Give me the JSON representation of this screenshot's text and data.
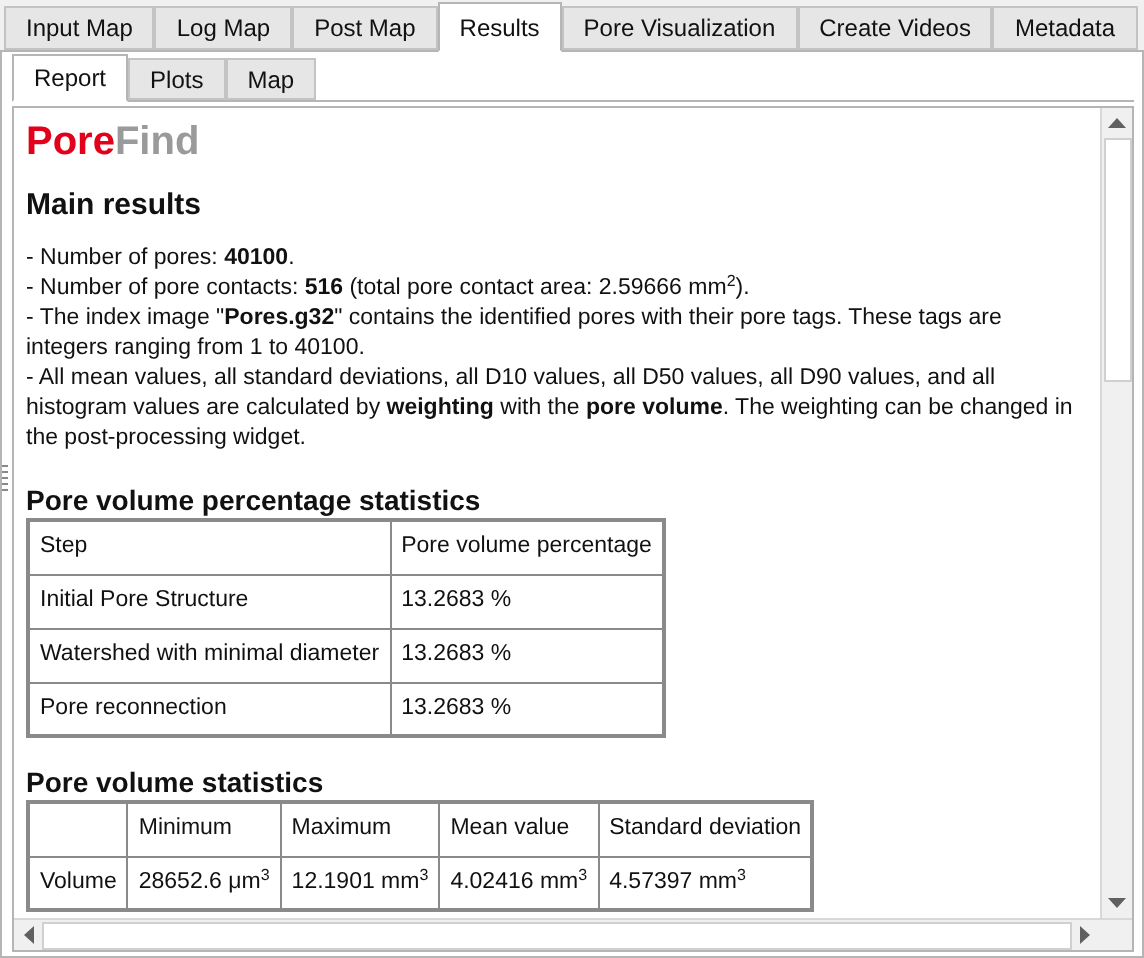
{
  "tabs": [
    {
      "label": "Input Map",
      "selected": false
    },
    {
      "label": "Log Map",
      "selected": false
    },
    {
      "label": "Post Map",
      "selected": false
    },
    {
      "label": "Results",
      "selected": true
    },
    {
      "label": "Pore Visualization",
      "selected": false
    },
    {
      "label": "Create Videos",
      "selected": false
    },
    {
      "label": "Metadata",
      "selected": false
    }
  ],
  "subtabs": [
    {
      "label": "Report",
      "selected": true
    },
    {
      "label": "Plots",
      "selected": false
    },
    {
      "label": "Map",
      "selected": false
    }
  ],
  "report": {
    "logo": [
      "Pore",
      "Find"
    ],
    "main_heading": "Main results",
    "lines": [
      "- Number of pores: **40100**.",
      "- Number of pore contacts: **516** (total pore contact area: 2.59666 mm$^{2}$).",
      "- The index image \"**Pores.g32**\" contains the identified pores with their pore tags. These tags are integers ranging from 1 to 40100.",
      "- All mean values, all standard deviations, all D10 values, all D50 values, all D90 values, and all histogram values are calculated by **weighting** with the **pore volume**. The weighting can be changed in the post-processing widget."
    ],
    "tables": [
      {
        "title": "Pore volume percentage statistics",
        "columns": [
          "Step",
          "Pore volume percentage"
        ],
        "rows": [
          [
            "Initial Pore Structure",
            "13.2683 %"
          ],
          [
            "Watershed with minimal diameter",
            "13.2683 %"
          ],
          [
            "Pore reconnection",
            "13.2683 %"
          ]
        ]
      },
      {
        "title": "Pore volume statistics",
        "columns": [
          "",
          "Minimum",
          "Maximum",
          "Mean value",
          "Standard deviation"
        ],
        "rows": [
          [
            "Volume",
            "28652.6 μm$^{3}$",
            "12.1901 mm$^{3}$",
            "4.02416 mm$^{3}$",
            "4.57397 mm$^{3}$"
          ]
        ]
      }
    ]
  }
}
